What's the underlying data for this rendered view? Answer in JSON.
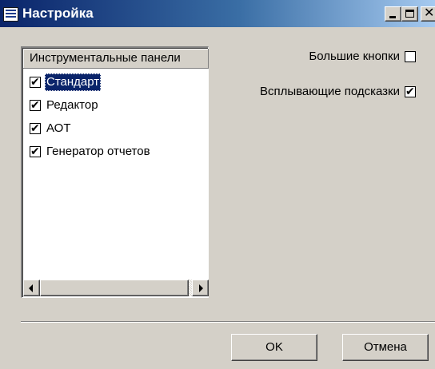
{
  "window": {
    "title": "Настройка"
  },
  "toolbars_panel": {
    "header": "Инструментальные панели",
    "items": [
      {
        "label": "Стандарт",
        "checked": true,
        "selected": true
      },
      {
        "label": "Редактор",
        "checked": true,
        "selected": false
      },
      {
        "label": "АОТ",
        "checked": true,
        "selected": false
      },
      {
        "label": "Генератор отчетов",
        "checked": true,
        "selected": false
      }
    ]
  },
  "options": {
    "large_buttons_label": "Большие кнопки",
    "large_buttons_checked": false,
    "tooltips_label": "Всплывающие подсказки",
    "tooltips_checked": true
  },
  "buttons": {
    "ok_label": "OK",
    "cancel_label": "Отмена"
  },
  "colors": {
    "titlebar_start": "#0a246a",
    "titlebar_end": "#a6caf0",
    "dialog_face": "#d4d0c8",
    "selection": "#0a246a"
  }
}
